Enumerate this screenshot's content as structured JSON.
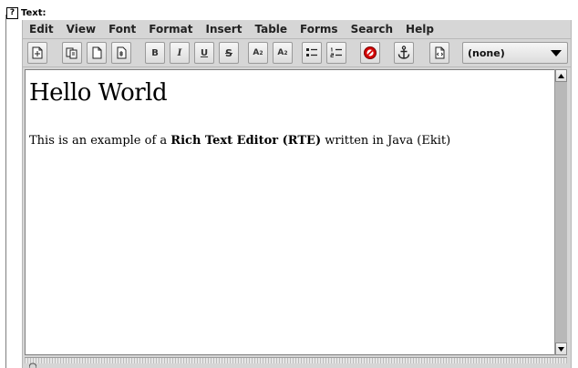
{
  "field": {
    "help_badge": "?",
    "label": "Text:"
  },
  "menu": [
    "Edit",
    "View",
    "Font",
    "Format",
    "Insert",
    "Table",
    "Forms",
    "Search",
    "Help"
  ],
  "toolbar": {
    "bold": "B",
    "italic": "I",
    "underline": "U",
    "strike": "S",
    "superscript_base": "A",
    "superscript_exp": "2",
    "subscript_base": "A",
    "subscript_exp": "2",
    "style_selected": "(none)"
  },
  "icons": [
    "new-document-icon",
    "copy-icon",
    "paste-icon",
    "paste-special-icon",
    "bulleted-list-icon",
    "numbered-list-icon",
    "unlink-icon",
    "anchor-icon",
    "insert-html-icon"
  ],
  "document": {
    "heading": "Hello World",
    "para_before": "This is an example of a ",
    "para_bold": "Rich Text Editor (RTE)",
    "para_after": " written in Java (Ekit)"
  },
  "colors": {
    "toolbar_bg": "#d6d6d6",
    "unlink_red": "#d40000"
  }
}
